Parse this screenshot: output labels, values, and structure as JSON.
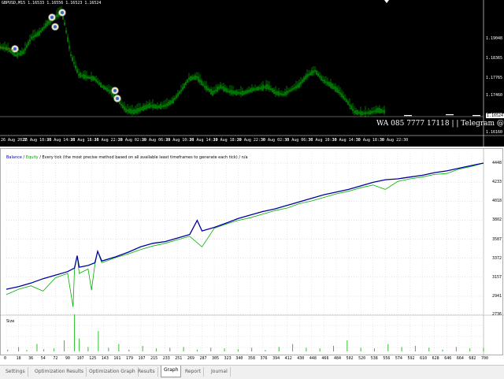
{
  "chart": {
    "title": "GBPUSD,M15  1.16533 1.16556 1.16523 1.16524",
    "price_labels": [
      "1.19048",
      "1.18365",
      "1.17765",
      "1.17460",
      "1.16995",
      "1.16524",
      "1.16160"
    ],
    "current_price": "1.16524",
    "time_labels": [
      "26 Aug 2022",
      "26 Aug 10:30",
      "26 Aug 14:30",
      "26 Aug 18:30",
      "26 Aug 22:30",
      "29 Aug 02:30",
      "29 Aug 06:30",
      "29 Aug 10:30",
      "29 Aug 14:30",
      "29 Aug 18:30",
      "29 Aug 22:30",
      "30 Aug 02:30",
      "30 Aug 06:30",
      "30 Aug 10:30",
      "30 Aug 14:30",
      "30 Aug 18:30",
      "30 Aug 22:30"
    ],
    "watermark": "WA 085 7777 17118 | | Telegram @Tomosie",
    "colors": {
      "bull": "#00c000",
      "bear": "#00c000",
      "background": "#000000"
    }
  },
  "graph": {
    "legend": {
      "balance": "Balance",
      "sep": " / ",
      "equity": "Equity",
      "rest": " / Every tick (the most precise method based on all available least timeframes to generate each tick) / n/a"
    },
    "size_label": "Size",
    "colors": {
      "balance": "#0000a0",
      "equity": "#00b000",
      "size": "#30c030"
    }
  },
  "chart_data": {
    "type": "line",
    "ylim": [
      2736,
      4448
    ],
    "yticks": [
      "4448",
      "4233",
      "4018",
      "3802",
      "3587",
      "3372",
      "3157",
      "2941",
      "2736"
    ],
    "xticks": [
      "0",
      "18",
      "36",
      "54",
      "72",
      "90",
      "107",
      "125",
      "143",
      "161",
      "179",
      "197",
      "215",
      "233",
      "251",
      "269",
      "287",
      "305",
      "323",
      "340",
      "358",
      "376",
      "394",
      "412",
      "430",
      "448",
      "466",
      "484",
      "502",
      "520",
      "538",
      "556",
      "574",
      "592",
      "610",
      "628",
      "646",
      "664",
      "682",
      "700"
    ],
    "series": [
      {
        "name": "Balance",
        "x": [
          0,
          18,
          36,
          54,
          72,
          90,
          100,
          104,
          107,
          120,
          125,
          130,
          134,
          140,
          161,
          179,
          197,
          215,
          233,
          251,
          260,
          269,
          280,
          287,
          305,
          323,
          340,
          358,
          376,
          394,
          412,
          430,
          448,
          466,
          484,
          502,
          520,
          538,
          556,
          574,
          592,
          610,
          628,
          646,
          664,
          682,
          700
        ],
        "y": [
          3020,
          3050,
          3090,
          3140,
          3180,
          3220,
          3260,
          3400,
          3270,
          3290,
          3305,
          3320,
          3450,
          3340,
          3390,
          3440,
          3500,
          3540,
          3560,
          3600,
          3620,
          3640,
          3800,
          3680,
          3720,
          3770,
          3820,
          3860,
          3900,
          3930,
          3970,
          4010,
          4050,
          4090,
          4120,
          4150,
          4190,
          4230,
          4260,
          4270,
          4290,
          4310,
          4340,
          4360,
          4390,
          4420,
          4448
        ]
      },
      {
        "name": "Equity",
        "x": [
          0,
          18,
          36,
          54,
          72,
          90,
          98,
          100,
          104,
          107,
          120,
          125,
          130,
          134,
          140,
          161,
          179,
          197,
          215,
          233,
          251,
          269,
          287,
          305,
          323,
          340,
          358,
          376,
          394,
          412,
          430,
          448,
          466,
          484,
          502,
          520,
          538,
          556,
          574,
          592,
          610,
          628,
          646,
          664,
          682,
          700
        ],
        "y": [
          2960,
          3020,
          3060,
          3000,
          3150,
          3200,
          2820,
          3250,
          3400,
          3200,
          3250,
          3010,
          3300,
          3450,
          3320,
          3380,
          3420,
          3470,
          3510,
          3540,
          3580,
          3620,
          3500,
          3710,
          3760,
          3800,
          3830,
          3870,
          3910,
          3940,
          3990,
          4020,
          4060,
          4100,
          4130,
          4170,
          4200,
          4150,
          4240,
          4270,
          4290,
          4320,
          4330,
          4380,
          4410,
          4448
        ]
      }
    ],
    "size": {
      "x": [
        2,
        18,
        30,
        45,
        55,
        70,
        85,
        100,
        107,
        120,
        135,
        150,
        165,
        180,
        200,
        220,
        240,
        260,
        280,
        300,
        320,
        340,
        360,
        380,
        400,
        420,
        440,
        460,
        480,
        500,
        520,
        540,
        560,
        580,
        600,
        620,
        640,
        660,
        680,
        700
      ],
      "y": [
        0.05,
        0.12,
        0.04,
        0.2,
        0.06,
        0.08,
        0.3,
        1.0,
        0.35,
        0.12,
        0.55,
        0.1,
        0.2,
        0.05,
        0.15,
        0.08,
        0.1,
        0.12,
        0.05,
        0.1,
        0.08,
        0.06,
        0.1,
        0.04,
        0.12,
        0.2,
        0.1,
        0.08,
        0.15,
        0.3,
        0.1,
        0.08,
        0.2,
        0.12,
        0.15,
        0.1,
        0.05,
        0.12,
        0.08,
        0.1
      ]
    }
  },
  "tabs": {
    "items": [
      {
        "label": "Settings"
      },
      {
        "label": "Optimization Results"
      },
      {
        "label": "Optimization Graph"
      },
      {
        "label": "Results"
      },
      {
        "label": "Graph"
      },
      {
        "label": "Report"
      },
      {
        "label": "Journal"
      }
    ],
    "active": "Graph"
  }
}
